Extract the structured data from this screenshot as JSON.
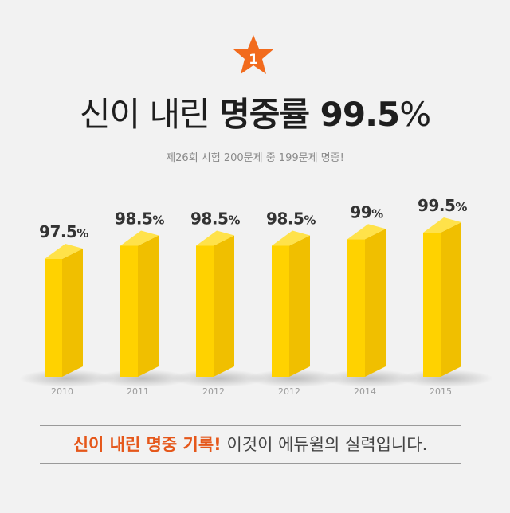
{
  "badge": {
    "number": "1"
  },
  "title": {
    "prefix": "신이 내린 ",
    "emphasis": "명중률 99.5",
    "suffix": "%"
  },
  "subtitle": "제26회 시험 200문제 중 199문제 명중!",
  "chart_data": {
    "type": "bar",
    "categories": [
      "2010",
      "2011",
      "2012",
      "2012",
      "2014",
      "2015"
    ],
    "values": [
      97.5,
      98.5,
      98.5,
      98.5,
      99,
      99.5
    ],
    "value_labels": [
      "97.5",
      "98.5",
      "98.5",
      "98.5",
      "99",
      "99.5"
    ],
    "unit": "%",
    "title": "",
    "xlabel": "",
    "ylabel": "",
    "grid": false,
    "legend": "none",
    "colors": {
      "front": "#FFD200",
      "side": "#F0BF00",
      "top": "#FFE24A"
    }
  },
  "tagline": {
    "highlight": "신이 내린 명중 기록!",
    "rest": " 이것이 에듀윌의 실력입니다."
  },
  "colors": {
    "accent": "#E5571A",
    "star": "#F26B1D",
    "text": "#1E1E1E"
  }
}
